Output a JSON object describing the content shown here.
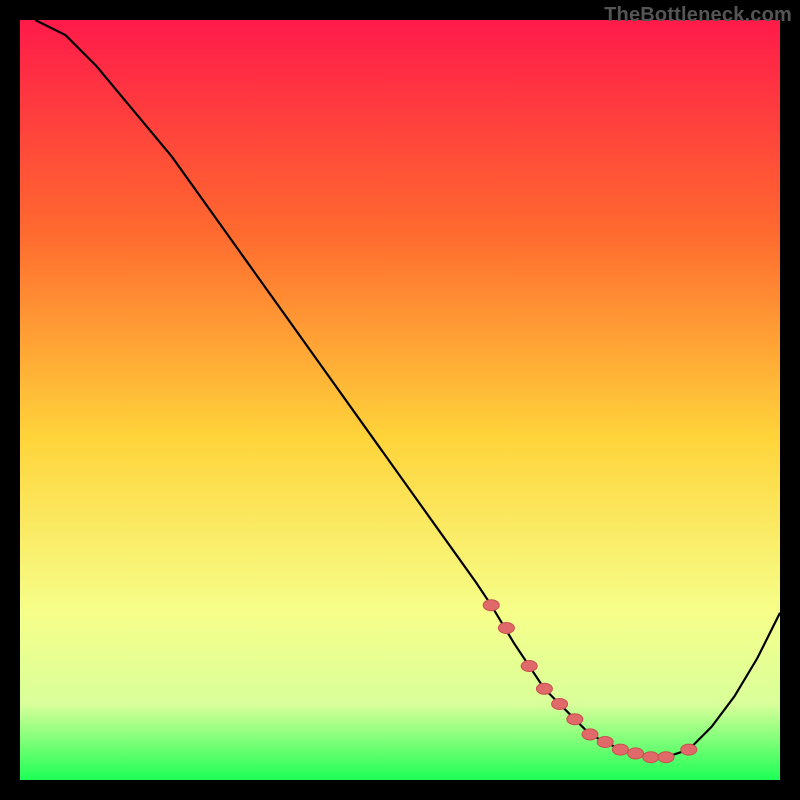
{
  "watermark": "TheBottleneck.com",
  "colors": {
    "gradient_top": "#ff1a4a",
    "gradient_mid1": "#ff7a2a",
    "gradient_mid2": "#ffe83a",
    "gradient_low": "#f9ffa0",
    "gradient_bottom": "#1dff56",
    "curve": "#000000",
    "dot_fill": "#e06a6a",
    "dot_stroke": "#c94f4f",
    "background": "#000000"
  },
  "chart_data": {
    "type": "line",
    "title": "",
    "xlabel": "",
    "ylabel": "",
    "xlim": [
      0,
      100
    ],
    "ylim": [
      0,
      100
    ],
    "series": [
      {
        "name": "bottleneck-curve",
        "x": [
          2,
          6,
          10,
          15,
          20,
          25,
          30,
          35,
          40,
          45,
          50,
          55,
          60,
          62,
          65,
          67,
          69,
          71,
          73,
          75,
          77,
          79,
          81,
          83,
          85,
          88,
          91,
          94,
          97,
          100
        ],
        "y": [
          100,
          98,
          94,
          88,
          82,
          75,
          68,
          61,
          54,
          47,
          40,
          33,
          26,
          23,
          18,
          15,
          12,
          10,
          8,
          6,
          5,
          4,
          3.5,
          3,
          3,
          4,
          7,
          11,
          16,
          22
        ]
      }
    ],
    "markers": {
      "name": "highlighted-points",
      "x": [
        62,
        64,
        67,
        69,
        71,
        73,
        75,
        77,
        79,
        81,
        83,
        85,
        88
      ],
      "y": [
        23,
        20,
        15,
        12,
        10,
        8,
        6,
        5,
        4,
        3.5,
        3,
        3,
        4
      ]
    }
  }
}
